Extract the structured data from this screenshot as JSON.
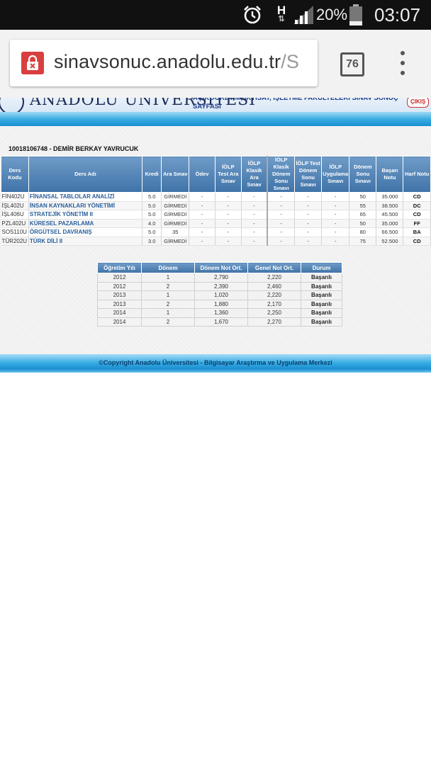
{
  "status_bar": {
    "alarm_icon": "alarm-clock-icon",
    "network_type": "H",
    "battery_percent": "20%",
    "time": "03:07"
  },
  "browser": {
    "url_host": "sinavsonuc.anadolu.edu.tr",
    "url_rest": "/S",
    "tab_count": "76",
    "security_icon": "insecure-lock-icon",
    "menu_icon": "overflow-menu-icon"
  },
  "header": {
    "university": "ANADOLU ÜNİVERSİTESİ",
    "subtitle": "AÇIKÖĞRETİM, İKTİSAT, İŞLETME FAKÜLTELERİ SINAV SONUÇ SAYFASI",
    "exit_label": "ÇIKIŞ"
  },
  "student": {
    "label": "10018106748 - DEMİR BERKAY YAVRUCUK"
  },
  "courses": {
    "columns": [
      "Ders Kodu",
      "Ders Adı",
      "Kredi",
      "Ara Sınav",
      "Ödev",
      "İÖLP Test Ara Sınav",
      "İÖLP Klasik Ara Sınav",
      "İÖLP Klasik Dönem Sonu Sınavı",
      "İÖLP Test Dönem Sonu Sınavı",
      "İÖLP Uygulama Sınavı",
      "Dönem Sonu Sınavı",
      "Başarı Notu",
      "Harf Notu"
    ],
    "rows": [
      [
        "FİN402U",
        "FİNANSAL TABLOLAR ANALİZİ",
        "5.0",
        "GİRMEDİ",
        "-",
        "-",
        "-",
        "-",
        "-",
        "-",
        "50",
        "35.000",
        "CD"
      ],
      [
        "İŞL402U",
        "İNSAN KAYNAKLARI YÖNETİMİ",
        "5.0",
        "GİRMEDİ",
        "-",
        "-",
        "-",
        "-",
        "-",
        "-",
        "55",
        "38.500",
        "DC"
      ],
      [
        "İŞL406U",
        "STRATEJİK YÖNETİM II",
        "5.0",
        "GİRMEDİ",
        "-",
        "-",
        "-",
        "-",
        "-",
        "-",
        "65",
        "45.500",
        "CD"
      ],
      [
        "PZL402U",
        "KÜRESEL PAZARLAMA",
        "4.0",
        "GİRMEDİ",
        "-",
        "-",
        "-",
        "-",
        "-",
        "-",
        "50",
        "35.000",
        "FF"
      ],
      [
        "SOS110U",
        "ÖRGÜTSEL DAVRANIŞ",
        "5.0",
        "35",
        "-",
        "-",
        "-",
        "-",
        "-",
        "-",
        "80",
        "66.500",
        "BA"
      ],
      [
        "TÜR202U",
        "TÜRK DİLİ II",
        "3.0",
        "GİRMEDİ",
        "-",
        "-",
        "-",
        "-",
        "-",
        "-",
        "75",
        "52.500",
        "CD"
      ]
    ]
  },
  "summary": {
    "columns": [
      "Öğretim Yılı",
      "Dönem",
      "Dönem Not Ort.",
      "Genel Not Ort.",
      "Durum"
    ],
    "rows": [
      [
        "2012",
        "1",
        "2,790",
        "2,220",
        "Başarılı"
      ],
      [
        "2012",
        "2",
        "2,390",
        "2,460",
        "Başarılı"
      ],
      [
        "2013",
        "1",
        "1,020",
        "2,220",
        "Başarılı"
      ],
      [
        "2013",
        "2",
        "1,880",
        "2,170",
        "Başarılı"
      ],
      [
        "2014",
        "1",
        "1,360",
        "2,250",
        "Başarılı"
      ],
      [
        "2014",
        "2",
        "1,670",
        "2,270",
        "Başarılı"
      ]
    ]
  },
  "footer": {
    "text": "©Copyright Anadolu Üniversitesi - Bilgisayar Araştırma ve Uygulama Merkezi"
  },
  "colors": {
    "header_blue": "#3f73a8",
    "link_blue": "#2b5f9c",
    "band_blue": "#34a9e2",
    "lock_red": "#d93f3f"
  }
}
